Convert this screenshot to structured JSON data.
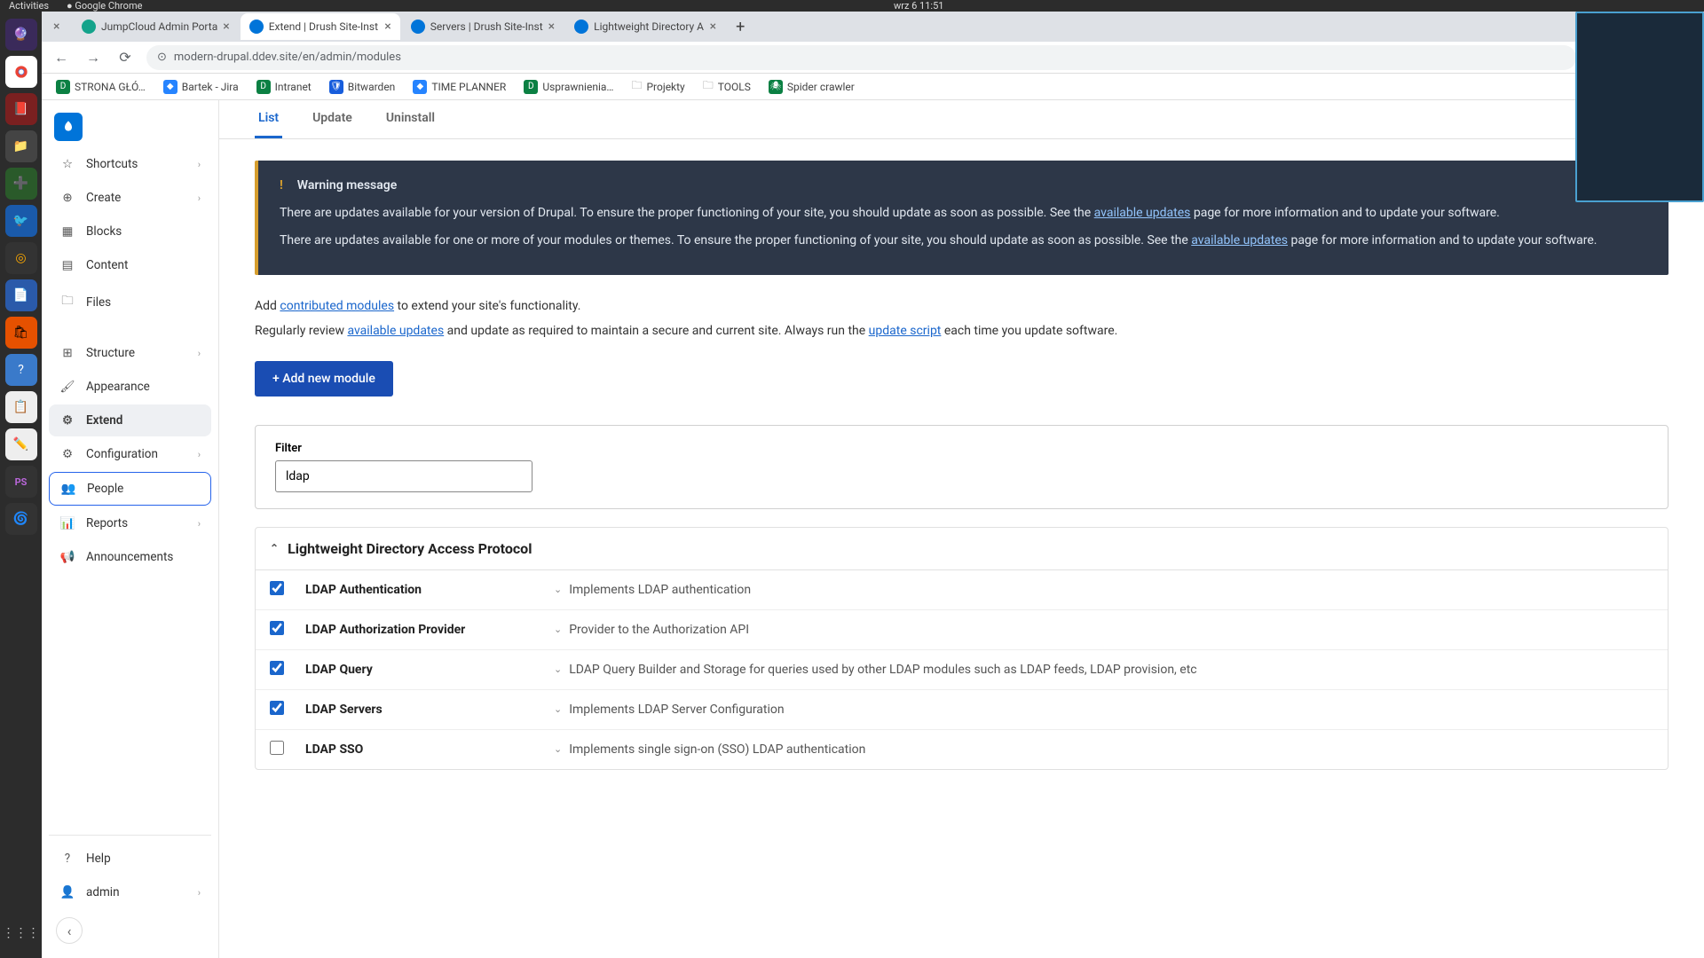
{
  "os": {
    "activities": "Activities",
    "app": "Google Chrome",
    "clock": "wrz 6  11:51"
  },
  "tabs": [
    {
      "title": "JumpCloud Admin Porta",
      "active": false
    },
    {
      "title": "Extend | Drush Site-Inst",
      "active": true
    },
    {
      "title": "Servers | Drush Site-Inst",
      "active": false
    },
    {
      "title": "Lightweight Directory A",
      "active": false
    }
  ],
  "url": "modern-drupal.ddev.site/en/admin/modules",
  "bookmarks": [
    {
      "label": "STRONA GŁÓ…",
      "color": "#0b8043"
    },
    {
      "label": "Bartek - Jira",
      "color": "#2684ff"
    },
    {
      "label": "Intranet",
      "color": "#0b8043"
    },
    {
      "label": "Bitwarden",
      "color": "#175ddc"
    },
    {
      "label": "TIME PLANNER",
      "color": "#2684ff"
    },
    {
      "label": "Usprawnienia…",
      "color": "#0b8043"
    },
    {
      "label": "Projekty",
      "color": "#888"
    },
    {
      "label": "TOOLS",
      "color": "#888"
    },
    {
      "label": "Spider crawler",
      "color": "#0b8043"
    }
  ],
  "sidebar": {
    "items": [
      {
        "label": "Shortcuts",
        "icon": "star",
        "chev": true
      },
      {
        "label": "Create",
        "icon": "plus",
        "chev": true
      },
      {
        "label": "Blocks",
        "icon": "grid"
      },
      {
        "label": "Content",
        "icon": "file"
      },
      {
        "label": "Files",
        "icon": "folder"
      },
      {
        "label": "Structure",
        "icon": "tree",
        "chev": true
      },
      {
        "label": "Appearance",
        "icon": "brush"
      },
      {
        "label": "Extend",
        "icon": "puzzle",
        "active": true
      },
      {
        "label": "Configuration",
        "icon": "sliders",
        "chev": true
      },
      {
        "label": "People",
        "icon": "users",
        "highlighted": true
      },
      {
        "label": "Reports",
        "icon": "chart",
        "chev": true
      },
      {
        "label": "Announcements",
        "icon": "megaphone"
      }
    ],
    "bottom": [
      {
        "label": "Help",
        "icon": "help"
      },
      {
        "label": "admin",
        "icon": "user",
        "chev": true
      }
    ]
  },
  "pageTabs": [
    {
      "label": "List",
      "active": true
    },
    {
      "label": "Update"
    },
    {
      "label": "Uninstall"
    }
  ],
  "warning": {
    "title": "Warning message",
    "p1a": "There are updates available for your version of Drupal. To ensure the proper functioning of your site, you should update as soon as possible. See the ",
    "p1link": "available updates",
    "p1b": " page for more information and to update your software.",
    "p2a": "There are updates available for one or more of your modules or themes. To ensure the proper functioning of your site, you should update as soon as possible. See the ",
    "p2link": "available updates",
    "p2b": " page for more information and to update your software."
  },
  "intro": {
    "l1a": "Add ",
    "l1link": "contributed modules",
    "l1b": " to extend your site's functionality.",
    "l2a": "Regularly review ",
    "l2link1": "available updates",
    "l2b": " and update as required to maintain a secure and current site. Always run the ",
    "l2link2": "update script",
    "l2c": " each time you update software."
  },
  "addBtn": "+ Add new module",
  "filter": {
    "label": "Filter",
    "value": "ldap"
  },
  "group": {
    "title": "Lightweight Directory Access Protocol",
    "modules": [
      {
        "name": "LDAP Authentication",
        "desc": "Implements LDAP authentication",
        "checked": true
      },
      {
        "name": "LDAP Authorization Provider",
        "desc": "Provider to the Authorization API",
        "checked": true
      },
      {
        "name": "LDAP Query",
        "desc": "LDAP Query Builder and Storage for queries used by other LDAP modules such as LDAP feeds, LDAP provision, etc",
        "checked": true
      },
      {
        "name": "LDAP Servers",
        "desc": "Implements LDAP Server Configuration",
        "checked": true
      },
      {
        "name": "LDAP SSO",
        "desc": "Implements single sign-on (SSO) LDAP authentication",
        "checked": false
      }
    ]
  }
}
